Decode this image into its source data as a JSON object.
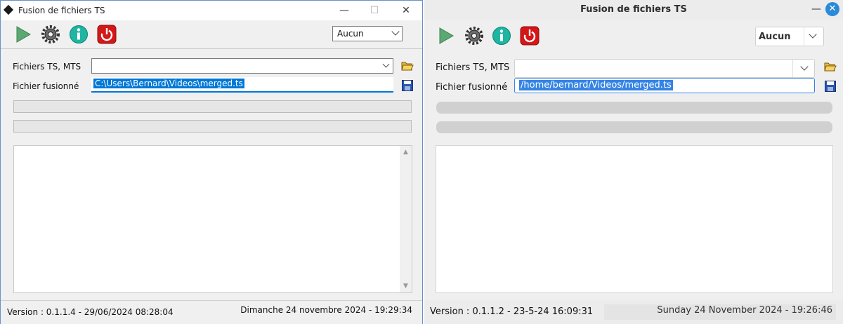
{
  "windows_app": {
    "title": "Fusion de fichiers TS",
    "minimize_glyph": "—",
    "maximize_glyph": "☐",
    "close_glyph": "✕",
    "toolbar": {
      "combo_value": "Aucun"
    },
    "labels": {
      "ts_files": "Fichiers TS, MTS",
      "merged_file": "Fichier fusionné"
    },
    "ts_files_value": "",
    "merged_file_value": "C:\\Users\\Bernard\\Videos\\merged.ts",
    "scroll_up_glyph": "▲",
    "scroll_down_glyph": "▼",
    "status": {
      "version": "Version : 0.1.1.4 - 29/06/2024 08:28:04",
      "date": "Dimanche 24 novembre 2024 - 19:29:34"
    }
  },
  "linux_app": {
    "title": "Fusion de fichiers TS",
    "minimize_glyph": "—",
    "close_glyph": "✕",
    "toolbar": {
      "combo_value": "Aucun"
    },
    "labels": {
      "ts_files": "Fichiers TS, MTS",
      "merged_file": "Fichier fusionné"
    },
    "ts_files_value": "",
    "merged_file_value": "/home/bernard/Videos/merged.ts",
    "status": {
      "version": "Version : 0.1.1.2 - 23-5-24 16:09:31",
      "date": "Sunday 24 November 2024 - 19:26:46"
    }
  },
  "icons": [
    "play-icon",
    "gear-icon",
    "info-icon",
    "power-icon",
    "folder-open-icon",
    "floppy-save-icon"
  ],
  "colors": {
    "win_selection": "#0078d7",
    "linux_selection": "#3584e4",
    "linux_close": "#2b8ad8"
  }
}
